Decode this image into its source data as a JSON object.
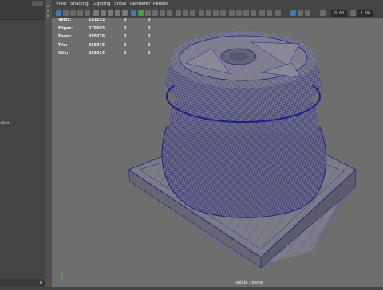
{
  "left_panel": {
    "partial_label": "dSet"
  },
  "menu": [
    "View",
    "Shading",
    "Lighting",
    "Show",
    "Renderer",
    "Panels"
  ],
  "toolbar": {
    "field1": "0.00",
    "field2": "1.00"
  },
  "hud_rows": [
    {
      "label": "Verts:",
      "v1": "183153",
      "v2": "0",
      "v3": "0"
    },
    {
      "label": "Edges:",
      "v1": "579303",
      "v2": "0",
      "v3": "0"
    },
    {
      "label": "Faces:",
      "v1": "395376",
      "v2": "0",
      "v3": "0"
    },
    {
      "label": "Tris:",
      "v1": "365376",
      "v2": "0",
      "v3": "0"
    },
    {
      "label": "UVs:",
      "v1": "203214",
      "v2": "0",
      "v3": "0"
    }
  ],
  "camera_label": "Isolate : persp",
  "colors": {
    "wire": "#20208a",
    "mesh": "#7a7a85",
    "viewport_bg": "#6e6e6e"
  }
}
